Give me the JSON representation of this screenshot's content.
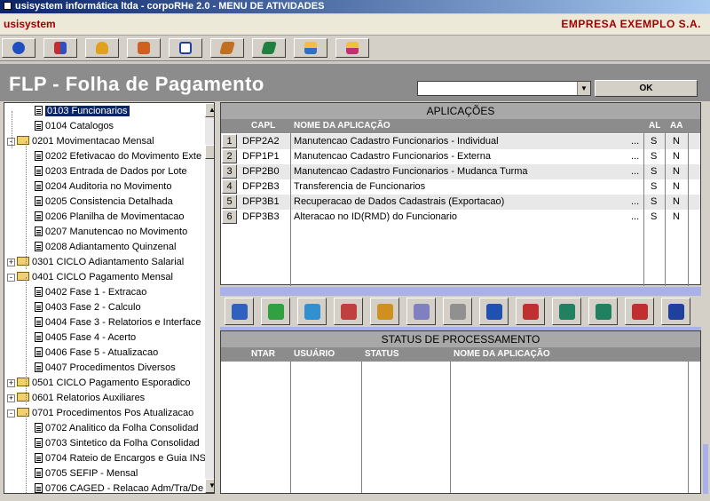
{
  "window": {
    "title": "usisystem informática ltda - corpoRHe 2.0 - MENU DE ATIVIDADES"
  },
  "menubar": {
    "brand": "usisystem",
    "company": "EMPRESA EXEMPLO S.A."
  },
  "colors": {
    "accent": "#a00000",
    "selection": "#0a246a",
    "band": "#aab0e8"
  },
  "toolbar": {
    "icons": [
      "back-icon",
      "users-icon",
      "hand-icon",
      "exit-icon",
      "report-icon",
      "book-icon",
      "book-green-icon",
      "network-icon",
      "network2-icon"
    ]
  },
  "header": {
    "title": "FLP - Folha de Pagamento",
    "ok_label": "OK",
    "combo_value": ""
  },
  "tree": {
    "items": [
      {
        "label": "0103 Funcionarios",
        "level": 2,
        "kind": "doc",
        "selected": true
      },
      {
        "label": "0104 Catalogos",
        "level": 2,
        "kind": "doc"
      },
      {
        "label": "0201 Movimentacao Mensal",
        "level": 1,
        "kind": "folder",
        "exp": "-"
      },
      {
        "label": "0202 Efetivacao do Movimento Exte",
        "level": 2,
        "kind": "doc"
      },
      {
        "label": "0203 Entrada de Dados por Lote",
        "level": 2,
        "kind": "doc"
      },
      {
        "label": "0204 Auditoria no Movimento",
        "level": 2,
        "kind": "doc"
      },
      {
        "label": "0205 Consistencia Detalhada",
        "level": 2,
        "kind": "doc"
      },
      {
        "label": "0206 Planilha de Movimentacao",
        "level": 2,
        "kind": "doc"
      },
      {
        "label": "0207 Manutencao no Movimento",
        "level": 2,
        "kind": "doc"
      },
      {
        "label": "0208 Adiantamento Quinzenal",
        "level": 2,
        "kind": "doc"
      },
      {
        "label": "0301 CICLO Adiantamento Salarial",
        "level": 1,
        "kind": "folder",
        "exp": "+"
      },
      {
        "label": "0401 CICLO Pagamento Mensal",
        "level": 1,
        "kind": "folder",
        "exp": "-"
      },
      {
        "label": "0402 Fase 1 - Extracao",
        "level": 2,
        "kind": "doc"
      },
      {
        "label": "0403 Fase 2 - Calculo",
        "level": 2,
        "kind": "doc"
      },
      {
        "label": "0404 Fase 3 - Relatorios e Interface",
        "level": 2,
        "kind": "doc"
      },
      {
        "label": "0405 Fase 4 - Acerto",
        "level": 2,
        "kind": "doc"
      },
      {
        "label": "0406 Fase 5 - Atualizacao",
        "level": 2,
        "kind": "doc"
      },
      {
        "label": "0407 Procedimentos Diversos",
        "level": 2,
        "kind": "doc"
      },
      {
        "label": "0501 CICLO Pagamento Esporadico",
        "level": 1,
        "kind": "folder",
        "exp": "+"
      },
      {
        "label": "0601 Relatorios Auxiliares",
        "level": 1,
        "kind": "folder",
        "exp": "+"
      },
      {
        "label": "0701 Procedimentos Pos Atualizacao",
        "level": 1,
        "kind": "folder",
        "exp": "-"
      },
      {
        "label": "0702 Analitico da Folha Consolidad",
        "level": 2,
        "kind": "doc"
      },
      {
        "label": "0703 Sintetico da Folha Consolidad",
        "level": 2,
        "kind": "doc"
      },
      {
        "label": "0704 Rateio de Encargos e Guia INS",
        "level": 2,
        "kind": "doc"
      },
      {
        "label": "0705 SEFIP - Mensal",
        "level": 2,
        "kind": "doc"
      },
      {
        "label": "0706 CAGED - Relacao Adm/Tra/De",
        "level": 2,
        "kind": "doc"
      }
    ]
  },
  "apps": {
    "title": "APLICAÇÕES",
    "columns": {
      "capl": "CAPL",
      "nome": "NOME DA APLICAÇÃO",
      "al": "AL",
      "aa": "AA"
    },
    "rows": [
      {
        "num": "1",
        "capl": "DFP2A2",
        "nome": "Manutencao Cadastro Funcionarios - Individual",
        "dots": "...",
        "al": "S",
        "aa": "N"
      },
      {
        "num": "2",
        "capl": "DFP1P1",
        "nome": "Manutencao Cadastro Funcionarios - Externa",
        "dots": "...",
        "al": "S",
        "aa": "N"
      },
      {
        "num": "3",
        "capl": "DFP2B0",
        "nome": "Manutencao Cadastro Funcionarios - Mudanca Turma",
        "dots": "...",
        "al": "S",
        "aa": "N"
      },
      {
        "num": "4",
        "capl": "DFP2B3",
        "nome": "Transferencia de Funcionarios",
        "dots": "",
        "al": "S",
        "aa": "N"
      },
      {
        "num": "5",
        "capl": "DFP3B1",
        "nome": "Recuperacao de Dados Cadastrais (Exportacao)",
        "dots": "...",
        "al": "S",
        "aa": "N"
      },
      {
        "num": "6",
        "capl": "DFP3B3",
        "nome": "Alteracao no ID(RMD) do Funcionario",
        "dots": "...",
        "al": "S",
        "aa": "N"
      }
    ]
  },
  "iconbar": {
    "icons": [
      "tree-icon",
      "tree-add-icon",
      "refresh-icon",
      "schedule-icon",
      "calculator-icon",
      "cd-icon",
      "printer-icon",
      "upload-doc-icon",
      "move-down-icon",
      "doc-export-icon",
      "doc-import-icon",
      "move-up-icon",
      "word-doc-icon"
    ]
  },
  "status": {
    "title": "STATUS DE PROCESSAMENTO",
    "columns": {
      "ntar": "NTAR",
      "usuario": "USUÁRIO",
      "status": "STATUS",
      "nome": "NOME DA APLICAÇÃO"
    }
  }
}
